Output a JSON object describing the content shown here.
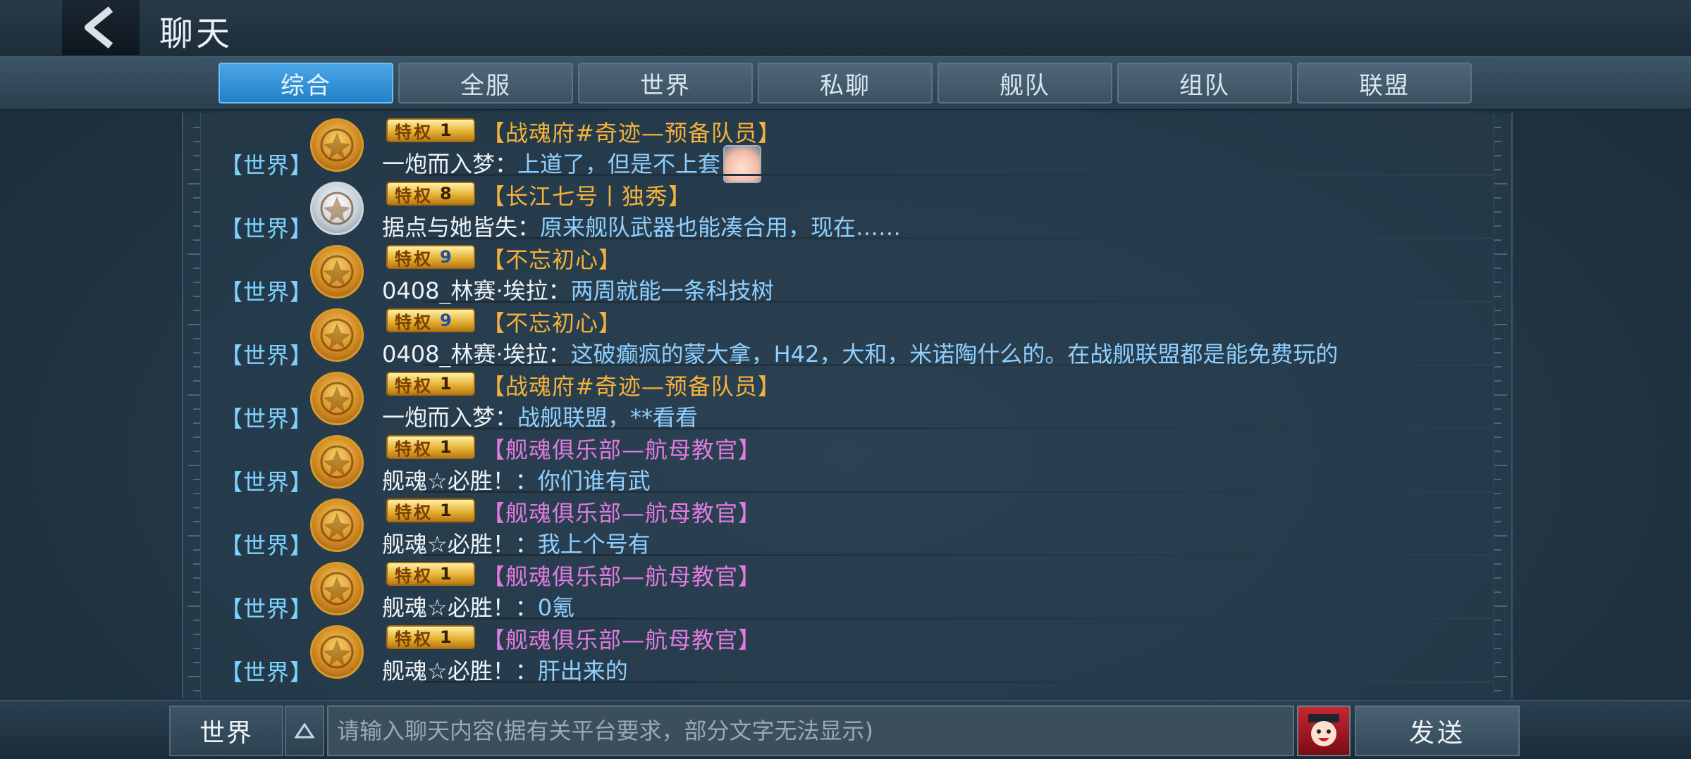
{
  "header": {
    "title": "聊天",
    "back_icon": "back-chevron-icon"
  },
  "tabs": [
    {
      "label": "综合",
      "active": true
    },
    {
      "label": "全服",
      "active": false
    },
    {
      "label": "世界",
      "active": false
    },
    {
      "label": "私聊",
      "active": false
    },
    {
      "label": "舰队",
      "active": false
    },
    {
      "label": "组队",
      "active": false
    },
    {
      "label": "联盟",
      "active": false
    }
  ],
  "messages": [
    {
      "channel": "【世界】",
      "avatar": "gold",
      "badge": "特权",
      "level": "1",
      "badge_style": "gold",
      "guild": "【战魂府#奇迹—预备队员】",
      "guild_color": "#f4b23c",
      "sender": "一炮而入梦",
      "sep": "：",
      "text": "上道了，但是不上套",
      "sticker": true
    },
    {
      "channel": "【世界】",
      "avatar": "silver",
      "badge": "特权",
      "level": "8",
      "badge_style": "gold",
      "guild": "【长江七号丨独秀】",
      "guild_color": "#f4b23c",
      "sender": "据点与她皆失",
      "sep": "：",
      "text": "原来舰队武器也能凑合用，现在……",
      "sticker": false
    },
    {
      "channel": "【世界】",
      "avatar": "gold",
      "badge": "特权",
      "level": "9",
      "badge_style": "blue",
      "guild": "【不忘初心】",
      "guild_color": "#f4b23c",
      "sender": "0408_林赛·埃拉",
      "sep": "：",
      "text": "两周就能一条科技树",
      "sticker": false
    },
    {
      "channel": "【世界】",
      "avatar": "gold",
      "badge": "特权",
      "level": "9",
      "badge_style": "blue",
      "guild": "【不忘初心】",
      "guild_color": "#f4b23c",
      "sender": "0408_林赛·埃拉",
      "sep": "：",
      "text": "这破癫疯的蒙大拿，H42，大和，米诺陶什么的。在战舰联盟都是能免费玩的",
      "sticker": false
    },
    {
      "channel": "【世界】",
      "avatar": "gold",
      "badge": "特权",
      "level": "1",
      "badge_style": "gold",
      "guild": "【战魂府#奇迹—预备队员】",
      "guild_color": "#f4b23c",
      "sender": "一炮而入梦",
      "sep": "：",
      "text": "战舰联盟，**看看",
      "sticker": false
    },
    {
      "channel": "【世界】",
      "avatar": "gold",
      "badge": "特权",
      "level": "1",
      "badge_style": "gold",
      "guild": "【舰魂俱乐部—航母教官】",
      "guild_color": "#e07adf",
      "sender": "舰魂☆必胜！",
      "sep": "：",
      "text": "你们谁有武",
      "sticker": false
    },
    {
      "channel": "【世界】",
      "avatar": "gold",
      "badge": "特权",
      "level": "1",
      "badge_style": "gold",
      "guild": "【舰魂俱乐部—航母教官】",
      "guild_color": "#e07adf",
      "sender": "舰魂☆必胜！",
      "sep": "：",
      "text": "我上个号有",
      "sticker": false
    },
    {
      "channel": "【世界】",
      "avatar": "gold",
      "badge": "特权",
      "level": "1",
      "badge_style": "gold",
      "guild": "【舰魂俱乐部—航母教官】",
      "guild_color": "#e07adf",
      "sender": "舰魂☆必胜！",
      "sep": "：",
      "text": "0氪",
      "sticker": false
    },
    {
      "channel": "【世界】",
      "avatar": "gold",
      "badge": "特权",
      "level": "1",
      "badge_style": "gold",
      "guild": "【舰魂俱乐部—航母教官】",
      "guild_color": "#e07adf",
      "sender": "舰魂☆必胜！",
      "sep": "：",
      "text": "肝出来的",
      "sticker": false
    }
  ],
  "footer": {
    "channel_select": "世界",
    "input_placeholder": "请输入聊天内容(据有关平台要求，部分文字无法显示)",
    "input_value": "",
    "send_label": "发送",
    "emoji_icon": "emoji-face-icon"
  },
  "colors": {
    "accent": "#2d8fd6",
    "channel_text": "#7ed2ff",
    "message_text": "#8fcfff",
    "sender_text": "#eef3f7"
  }
}
